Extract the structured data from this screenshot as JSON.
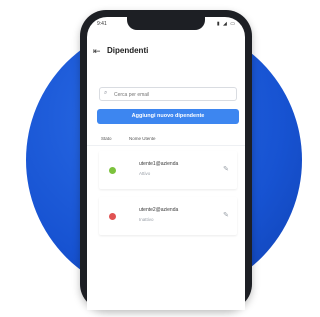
{
  "status_bar": {
    "time": "9:41",
    "icons": "▮ ◢ ▭"
  },
  "header": {
    "title": "Dipendenti",
    "back_icon": "arrow-left-icon"
  },
  "search": {
    "placeholder": "Cerca per email"
  },
  "add_button": {
    "label": "Aggiungi nuovo dipendente"
  },
  "table": {
    "columns": [
      "Stato",
      "Nome Utente"
    ],
    "rows": [
      {
        "email": "utente1@azienda",
        "status": "Attivo",
        "dot_color": "#7cc23d"
      },
      {
        "email": "utente2@azienda",
        "status": "Inattivo",
        "dot_color": "#e05252"
      }
    ]
  },
  "colors": {
    "accent": "#3d86f0",
    "background_circle": "#1753d2"
  }
}
